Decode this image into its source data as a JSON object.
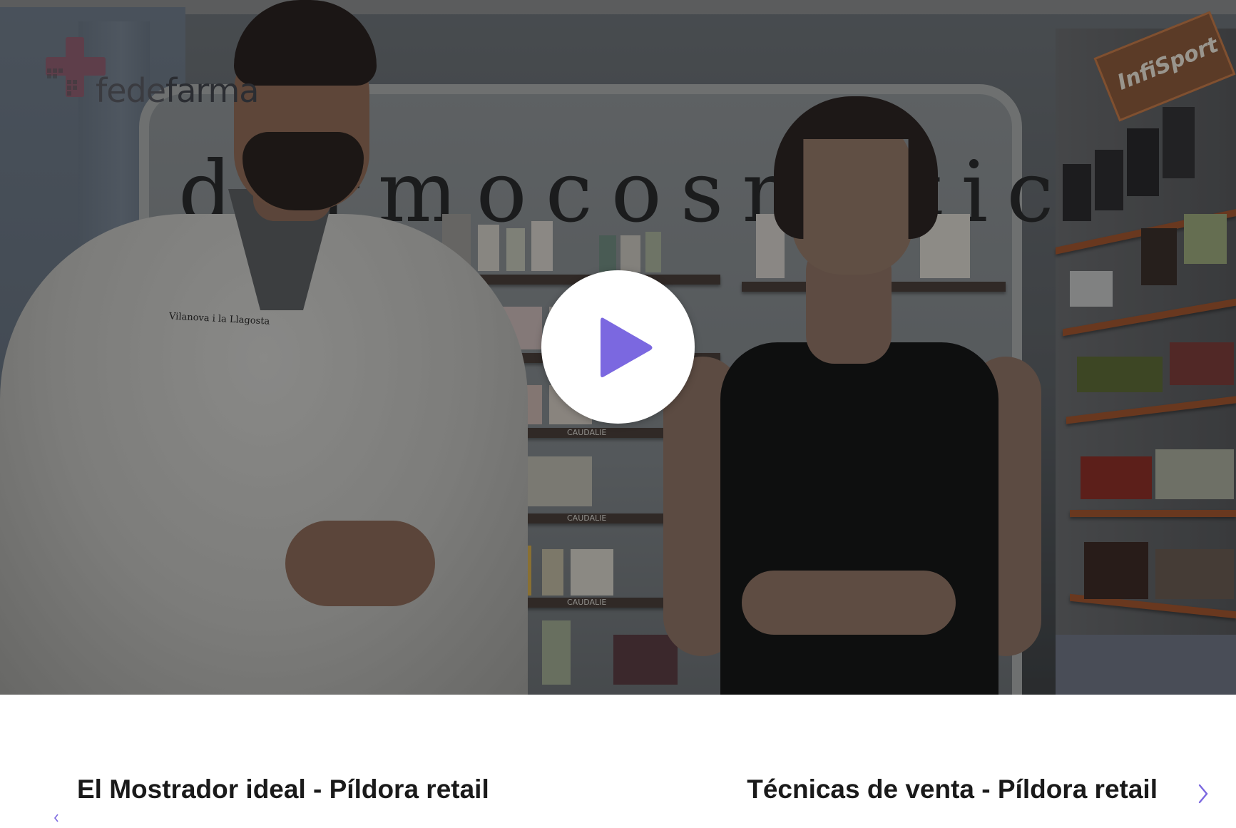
{
  "video": {
    "logo_text_light": "fede",
    "logo_text_bold": "farma",
    "sign_text": "dermocosmética",
    "badge_text": "Vilanova i la Llagosta",
    "rack_banner_text": "InfiSport",
    "shelf_label": "CAUDALIE",
    "play_icon": "play-icon"
  },
  "carousel": {
    "prev_title": "El Mostrador ideal - Píldora retail",
    "next_title": "Técnicas de venta - Píldora retail",
    "prev_icon": "chevron-left-icon",
    "next_icon": "chevron-right-icon"
  },
  "colors": {
    "play_accent": "#7b68e0",
    "logo_accent": "#c2185b"
  }
}
